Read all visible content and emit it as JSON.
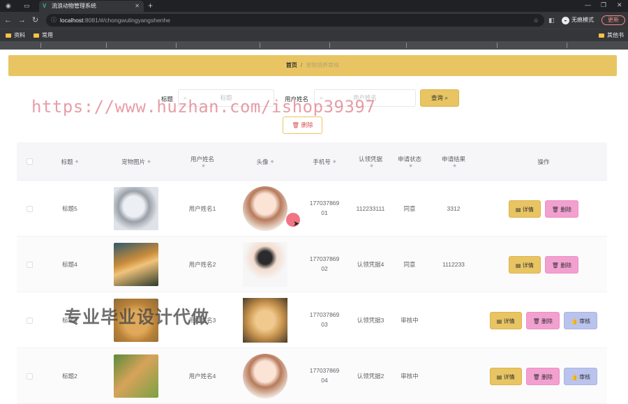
{
  "browser": {
    "tab_title": "流浪动物管理系统",
    "url_host": "localhost",
    "url_path": ":8081/#/chongwulingyangshenhe",
    "incognito_label": "无痕模式",
    "update_label": "更新",
    "bookmarks": [
      "资料",
      "常用"
    ],
    "bookmarks_right": "其他书签"
  },
  "breadcrumb": {
    "home": "首页",
    "separator": "/",
    "current": "宠物领养审核"
  },
  "search": {
    "title_label": "标题",
    "title_placeholder": "标题",
    "user_label": "用户姓名",
    "user_placeholder": "用户姓名",
    "query_button": "查询"
  },
  "toolbar": {
    "delete_label": "删除"
  },
  "table": {
    "headers": {
      "title": "标题",
      "pet_image": "宠物图片",
      "user_name": "用户姓名",
      "avatar": "头像",
      "phone": "手机号",
      "proof": "认领凭据",
      "status": "申请状态",
      "result": "申请结果",
      "actions": "操作"
    },
    "rows": [
      {
        "title": "标题5",
        "user_name": "用户姓名1",
        "phone_line1": "177037869",
        "phone_line2": "01",
        "proof": "112233111",
        "status": "同意",
        "result": "3312",
        "pet": "cat-white",
        "avatar": "girl"
      },
      {
        "title": "标题4",
        "user_name": "用户姓名2",
        "phone_line1": "177037869",
        "phone_line2": "02",
        "proof": "认领凭据4",
        "status": "同意",
        "result": "1112233",
        "pet": "corgi",
        "avatar": "boy"
      },
      {
        "title": "标题3",
        "user_name": "用户姓名3",
        "phone_line1": "177037869",
        "phone_line2": "03",
        "proof": "认领凭据3",
        "status": "审核中",
        "result": "",
        "pet": "puppy-brown",
        "avatar": "dog"
      },
      {
        "title": "标题2",
        "user_name": "用户姓名4",
        "phone_line1": "177037869",
        "phone_line2": "04",
        "proof": "认领凭据2",
        "status": "审核中",
        "result": "",
        "pet": "dogs-green",
        "avatar": "girl"
      }
    ],
    "action_labels": {
      "detail": "详情",
      "delete": "删除",
      "audit": "审核"
    }
  },
  "watermarks": {
    "url_text": "https://www.huzhan.com/ishop39397",
    "cn_text": "专业毕业设计代做"
  },
  "colors": {
    "accent": "#e8c562",
    "delete_pink": "#f2a0d0",
    "audit_blue": "#b9c3ec"
  }
}
